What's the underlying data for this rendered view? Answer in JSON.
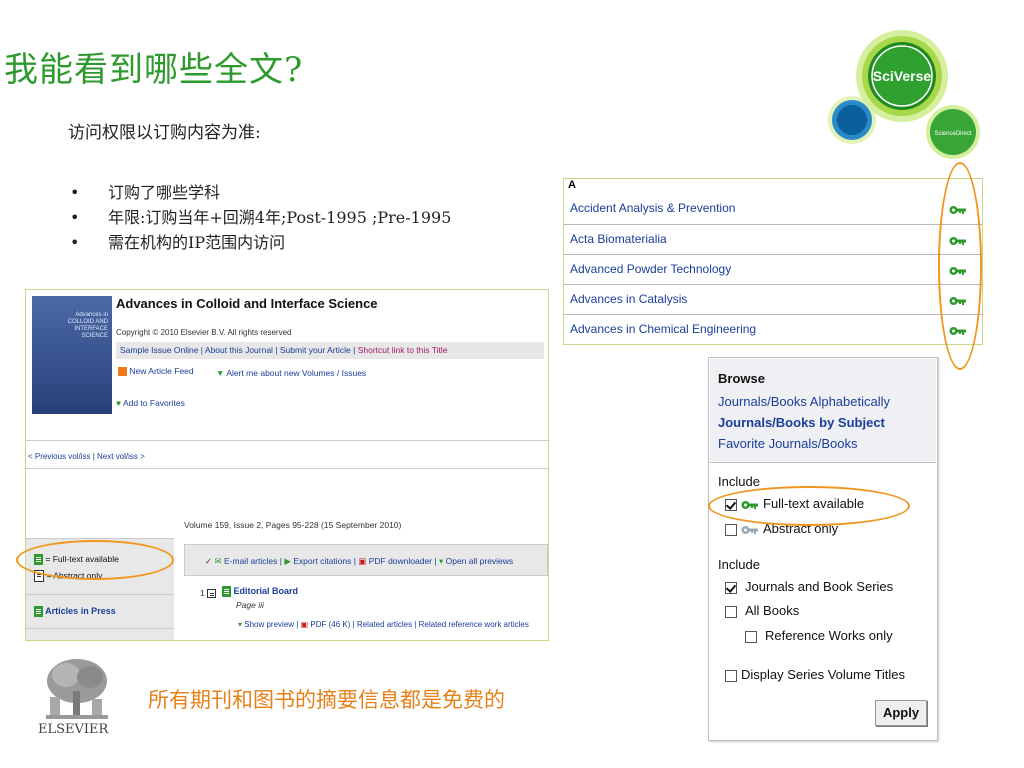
{
  "slide": {
    "title": "我能看到哪些全文?",
    "subtitle": "访问权限以订购内容为准:",
    "bullets": [
      "订购了哪些学科",
      "年限:订购当年+回溯4年;Post-1995 ;Pre-1995",
      "需在机构的IP范围内访问"
    ],
    "bullet_glyph": "•",
    "note": "所有期刊和图书的摘要信息都是免费的",
    "accent_color": "#2e9a2e",
    "note_color": "#e8801a",
    "highlight_color": "#f0961e"
  },
  "logos": {
    "sciverse": "SciVerse",
    "sciencedirect": "ScienceDirect",
    "elsevier": "ELSEVIER"
  },
  "journal_list": {
    "letter": "A",
    "items": [
      {
        "name": "Accident Analysis & Prevention",
        "icon": "key-icon"
      },
      {
        "name": "Acta Biomaterialia",
        "icon": "key-icon"
      },
      {
        "name": "Advanced Powder Technology",
        "icon": "key-icon"
      },
      {
        "name": "Advances in Catalysis",
        "icon": "key-icon"
      },
      {
        "name": "Advances in Chemical Engineering",
        "icon": "key-icon"
      }
    ]
  },
  "journal_page": {
    "cover_text": "Advances in COLLOID AND INTERFACE SCIENCE",
    "title": "Advances in Colloid and Interface Science",
    "copyright": "Copyright © 2010 Elsevier B.V. All rights reserved",
    "links": [
      "Sample Issue Online",
      "About this Journal",
      "Submit your Article",
      "Shortcut link to this Title"
    ],
    "new_article_feed": "New Article Feed",
    "alert": "Alert me about new Volumes / Issues",
    "add_favorites": "Add to Favorites",
    "prev": "< Previous vol/iss",
    "next": "Next vol/iss >",
    "volume": "Volume 159, Issue 2, Pages 95-228 (15 September 2010)",
    "legend_full": "= Full-text available",
    "legend_abstract": "= Abstract only",
    "articles_in_press": "Articles in Press",
    "tools": [
      "E-mail articles",
      "Export citations",
      "PDF downloader",
      "Open all previews"
    ],
    "article_num": "1",
    "article_title": "Editorial Board",
    "article_page": "Page iii",
    "article_links": [
      "Show preview",
      "PDF (46 K)",
      "Related articles",
      "Related reference work articles"
    ]
  },
  "browse": {
    "heading": "Browse",
    "links": [
      "Journals/Books Alphabetically",
      "Journals/Books by Subject",
      "Favorite Journals/Books"
    ],
    "include1_label": "Include",
    "full_text": "Full-text available",
    "abstract_only": "Abstract only",
    "include2_label": "Include",
    "journals_series": "Journals and Book Series",
    "all_books": "All Books",
    "reference_works": "Reference Works only",
    "display_series": "Display Series Volume Titles",
    "apply": "Apply",
    "checked": {
      "full_text": true,
      "abstract_only": false,
      "journals_series": true,
      "all_books": false,
      "reference_works": false,
      "display_series": false
    }
  }
}
